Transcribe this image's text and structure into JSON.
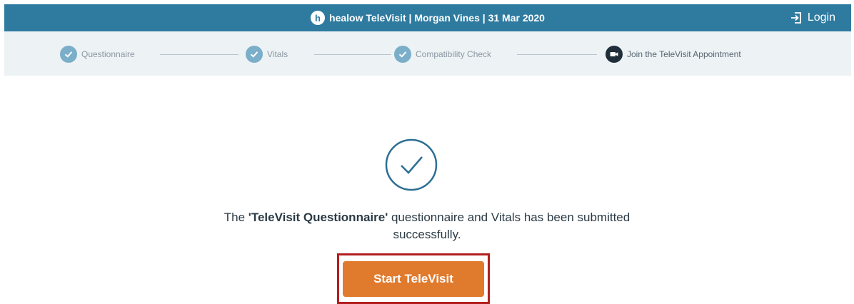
{
  "header": {
    "brand_letter": "h",
    "title": "healow TeleVisit | Morgan Vines | 31 Mar 2020",
    "login_label": "Login",
    "background": "#2f7ba0"
  },
  "steps": [
    {
      "label": "Questionnaire",
      "status": "complete",
      "icon": "check-icon"
    },
    {
      "label": "Vitals",
      "status": "complete",
      "icon": "check-icon"
    },
    {
      "label": "Compatibility Check",
      "status": "complete",
      "icon": "check-icon"
    },
    {
      "label": "Join the TeleVisit Appointment",
      "status": "current",
      "icon": "video-camera-icon"
    }
  ],
  "main": {
    "success_icon": "check-circle-icon",
    "message_prefix": "The ",
    "message_emphasis": "'TeleVisit Questionnaire'",
    "message_suffix": " questionnaire and Vitals has been submitted successfully.",
    "button_label": "Start TeleVisit",
    "button_color": "#e07a2d",
    "highlight_color": "#b21e1e"
  }
}
